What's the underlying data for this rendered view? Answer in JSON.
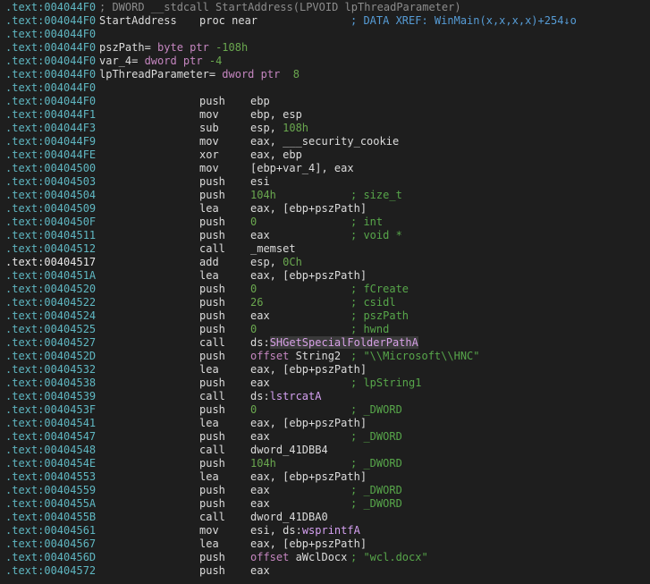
{
  "colors": {
    "background": "#1e1e1e",
    "address": "#5fb7c2",
    "comment": "#57a64a",
    "keyword": "#c586c0",
    "number": "#6aa84f",
    "xref": "#569cd6"
  },
  "lines": [
    {
      "addr": ".text:004044F0",
      "hdr": "; DWORD __stdcall StartAddress(LPVOID lpThreadParameter)"
    },
    {
      "addr": ".text:004044F0",
      "label": "StartAddress",
      "mnem": "proc near",
      "xref": "; DATA XREF: WinMain(x,x,x,x)+254↓o"
    },
    {
      "addr": ".text:004044F0"
    },
    {
      "addr": ".text:004044F0",
      "var_name": "pszPath",
      "var_eq": "= ",
      "var_type": "byte ptr",
      "var_val": "-108h"
    },
    {
      "addr": ".text:004044F0",
      "var_name": "var_4",
      "var_eq": "= ",
      "var_type": "dword ptr",
      "var_val": "-4"
    },
    {
      "addr": ".text:004044F0",
      "var_name": "lpThreadParameter",
      "var_eq": "= ",
      "var_type": "dword ptr",
      "var_val": " 8"
    },
    {
      "addr": ".text:004044F0"
    },
    {
      "addr": ".text:004044F0",
      "mnem": "push",
      "op": "ebp"
    },
    {
      "addr": ".text:004044F1",
      "mnem": "mov",
      "op": "ebp, esp"
    },
    {
      "addr": ".text:004044F3",
      "mnem": "sub",
      "op_a": "esp, ",
      "op_num": "108h"
    },
    {
      "addr": ".text:004044F9",
      "mnem": "mov",
      "op": "eax, ___security_cookie"
    },
    {
      "addr": ".text:004044FE",
      "mnem": "xor",
      "op": "eax, ebp"
    },
    {
      "addr": ".text:00404500",
      "mnem": "mov",
      "op": "[ebp+var_4], eax"
    },
    {
      "addr": ".text:00404503",
      "mnem": "push",
      "op": "esi"
    },
    {
      "addr": ".text:00404504",
      "mnem": "push",
      "op_num": "104h",
      "cmt": "; size_t"
    },
    {
      "addr": ".text:00404509",
      "mnem": "lea",
      "op": "eax, [ebp+pszPath]"
    },
    {
      "addr": ".text:0040450F",
      "mnem": "push",
      "op_num": "0",
      "cmt": "; int"
    },
    {
      "addr": ".text:00404511",
      "mnem": "push",
      "op": "eax",
      "cmt": "; void *"
    },
    {
      "addr": ".text:00404512",
      "mnem": "call",
      "op": "_memset"
    },
    {
      "addr": ".text:00404517",
      "mnem": "add",
      "op_a": "esp, ",
      "op_num": "0Ch",
      "sel": true
    },
    {
      "addr": ".text:0040451A",
      "mnem": "lea",
      "op": "eax, [ebp+pszPath]"
    },
    {
      "addr": ".text:00404520",
      "mnem": "push",
      "op_num": "0",
      "cmt": "; fCreate"
    },
    {
      "addr": ".text:00404522",
      "mnem": "push",
      "op_num": "26",
      "cmt": "; csidl"
    },
    {
      "addr": ".text:00404524",
      "mnem": "push",
      "op": "eax",
      "cmt": "; pszPath"
    },
    {
      "addr": ".text:00404525",
      "mnem": "push",
      "op_num": "0",
      "cmt": "; hwnd"
    },
    {
      "addr": ".text:00404527",
      "mnem": "call",
      "op_ds": "ds:",
      "op_imp_h": "SHGetSpecialFolderPathA"
    },
    {
      "addr": ".text:0040452D",
      "mnem": "push",
      "op_kw": "offset ",
      "op_b": "String2",
      "cmt": "; \"\\\\Microsoft\\\\HNC\""
    },
    {
      "addr": ".text:00404532",
      "mnem": "lea",
      "op": "eax, [ebp+pszPath]"
    },
    {
      "addr": ".text:00404538",
      "mnem": "push",
      "op": "eax",
      "cmt": "; lpString1"
    },
    {
      "addr": ".text:00404539",
      "mnem": "call",
      "op_ds": "ds:",
      "op_imp": "lstrcatA"
    },
    {
      "addr": ".text:0040453F",
      "mnem": "push",
      "op_num": "0",
      "cmt": "; _DWORD"
    },
    {
      "addr": ".text:00404541",
      "mnem": "lea",
      "op": "eax, [ebp+pszPath]"
    },
    {
      "addr": ".text:00404547",
      "mnem": "push",
      "op": "eax",
      "cmt": "; _DWORD"
    },
    {
      "addr": ".text:00404548",
      "mnem": "call",
      "op": "dword_41DBB4"
    },
    {
      "addr": ".text:0040454E",
      "mnem": "push",
      "op_num": "104h",
      "cmt": "; _DWORD"
    },
    {
      "addr": ".text:00404553",
      "mnem": "lea",
      "op": "eax, [ebp+pszPath]"
    },
    {
      "addr": ".text:00404559",
      "mnem": "push",
      "op": "eax",
      "cmt": "; _DWORD"
    },
    {
      "addr": ".text:0040455A",
      "mnem": "push",
      "op": "eax",
      "cmt": "; _DWORD"
    },
    {
      "addr": ".text:0040455B",
      "mnem": "call",
      "op": "dword_41DBA0"
    },
    {
      "addr": ".text:00404561",
      "mnem": "mov",
      "op_a": "esi, ",
      "op_ds": "ds:",
      "op_imp": "wsprintfA"
    },
    {
      "addr": ".text:00404567",
      "mnem": "lea",
      "op": "eax, [ebp+pszPath]"
    },
    {
      "addr": ".text:0040456D",
      "mnem": "push",
      "op_kw": "offset ",
      "op_b": "aWclDocx",
      "cmt": "; \"wcl.docx\""
    },
    {
      "addr": ".text:00404572",
      "mnem": "push",
      "op": "eax"
    }
  ]
}
